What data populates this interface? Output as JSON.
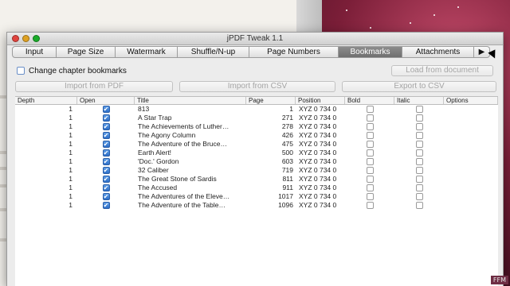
{
  "window": {
    "title": "jPDF Tweak 1.1"
  },
  "tabs": [
    {
      "label": "Input"
    },
    {
      "label": "Page Size"
    },
    {
      "label": "Watermark"
    },
    {
      "label": "Shuffle/N-up"
    },
    {
      "label": "Page Numbers"
    },
    {
      "label": "Bookmarks"
    },
    {
      "label": "Attachments"
    }
  ],
  "active_tab": "Bookmarks",
  "tab_scroll_icon": "triangle-right",
  "bookmarks": {
    "change_checkbox_label": "Change chapter bookmarks",
    "change_checked": false,
    "buttons": {
      "load_from_document": "Load from document",
      "import_from_pdf": "Import from PDF",
      "import_from_csv": "Import from CSV",
      "export_to_csv": "Export to CSV"
    }
  },
  "table": {
    "columns": [
      "Depth",
      "Open",
      "Title",
      "Page",
      "Position",
      "Bold",
      "Italic",
      "Options"
    ],
    "rows": [
      {
        "depth": "1",
        "open": true,
        "title": "813",
        "page": "1",
        "position": "XYZ 0 734 0",
        "bold": false,
        "italic": false
      },
      {
        "depth": "1",
        "open": true,
        "title": "A Star Trap",
        "page": "271",
        "position": "XYZ 0 734 0",
        "bold": false,
        "italic": false
      },
      {
        "depth": "1",
        "open": true,
        "title": "The Achievements of Luther…",
        "page": "278",
        "position": "XYZ 0 734 0",
        "bold": false,
        "italic": false
      },
      {
        "depth": "1",
        "open": true,
        "title": "The Agony Column",
        "page": "426",
        "position": "XYZ 0 734 0",
        "bold": false,
        "italic": false
      },
      {
        "depth": "1",
        "open": true,
        "title": "The Adventure of the Bruce…",
        "page": "475",
        "position": "XYZ 0 734 0",
        "bold": false,
        "italic": false
      },
      {
        "depth": "1",
        "open": true,
        "title": "Earth Alert!",
        "page": "500",
        "position": "XYZ 0 734 0",
        "bold": false,
        "italic": false
      },
      {
        "depth": "1",
        "open": true,
        "title": "'Doc.' Gordon",
        "page": "603",
        "position": "XYZ 0 734 0",
        "bold": false,
        "italic": false
      },
      {
        "depth": "1",
        "open": true,
        "title": "32 Caliber",
        "page": "719",
        "position": "XYZ 0 734 0",
        "bold": false,
        "italic": false
      },
      {
        "depth": "1",
        "open": true,
        "title": "The Great Stone of Sardis",
        "page": "811",
        "position": "XYZ 0 734 0",
        "bold": false,
        "italic": false
      },
      {
        "depth": "1",
        "open": true,
        "title": "The Accused",
        "page": "911",
        "position": "XYZ 0 734 0",
        "bold": false,
        "italic": false
      },
      {
        "depth": "1",
        "open": true,
        "title": "The Adventures of the Eleve…",
        "page": "1017",
        "position": "XYZ 0 734 0",
        "bold": false,
        "italic": false
      },
      {
        "depth": "1",
        "open": true,
        "title": "The Adventure of the Table…",
        "page": "1096",
        "position": "XYZ 0 734 0",
        "bold": false,
        "italic": false
      }
    ]
  },
  "watermark_badge": "FFM",
  "colors": {
    "active_tab": "#7a7a7a",
    "checkbox_checked": "#2d6fc8",
    "desktop_background": "#7b1e38"
  }
}
